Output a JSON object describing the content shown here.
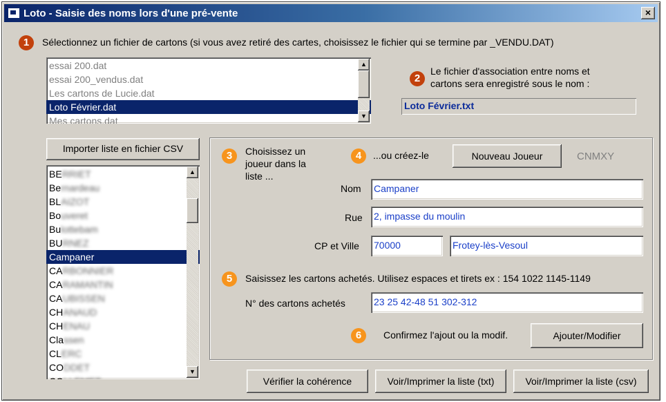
{
  "window": {
    "title": "Loto - Saisie des noms lors d'une pré-vente",
    "close_label": "×"
  },
  "steps": {
    "s1": "1",
    "s2": "2",
    "s3": "3",
    "s4": "4",
    "s5": "5",
    "s6": "6"
  },
  "step1": {
    "instruction": "Sélectionnez un fichier de cartons (si vous avez retiré des cartes, choisissez le fichier qui se termine par _VENDU.DAT)",
    "files": [
      "essai 200.dat",
      "essai 200_vendus.dat",
      "Les cartons de Lucie.dat",
      "Loto Février.dat",
      "Mes cartons.dat"
    ],
    "selected_index": 3
  },
  "step2": {
    "line1": "Le fichier d'association entre noms et",
    "line2": "cartons sera enregistré sous le nom :",
    "output_file": "Loto Février.txt"
  },
  "import_button": "Importer liste en fichier CSV",
  "players": {
    "items": [
      {
        "prefix": "BE",
        "rest": "RRIET"
      },
      {
        "prefix": "Be",
        "rest": "rnardeau"
      },
      {
        "prefix": "BL",
        "rest": "AIZOT"
      },
      {
        "prefix": "Bo",
        "rest": "uveret"
      },
      {
        "prefix": "Bu",
        "rest": "lottebam"
      },
      {
        "prefix": "BU",
        "rest": "RNEZ"
      },
      {
        "prefix": "Campaner",
        "rest": ""
      },
      {
        "prefix": "CA",
        "rest": "RBONNIER"
      },
      {
        "prefix": "CA",
        "rest": "RAMANTIN"
      },
      {
        "prefix": "CA",
        "rest": "UBISSEN"
      },
      {
        "prefix": "CH",
        "rest": "ANAUD"
      },
      {
        "prefix": "CH",
        "rest": "ENAU"
      },
      {
        "prefix": "Cla",
        "rest": "ssen"
      },
      {
        "prefix": "CL",
        "rest": "ERC"
      },
      {
        "prefix": "CO",
        "rest": "DDET"
      },
      {
        "prefix": "CO",
        "rest": "LLEMET"
      }
    ],
    "selected_index": 6
  },
  "step3": {
    "line1": "Choisissez un",
    "line2": "joueur dans la",
    "line3": "liste ..."
  },
  "step4": {
    "text": "...ou créez-le",
    "new_player_button": "Nouveau Joueur",
    "code": "CNMXY"
  },
  "form": {
    "nom_label": "Nom",
    "nom_value": "Campaner",
    "rue_label": "Rue",
    "rue_value": "2, impasse du moulin",
    "cp_label": "CP et Ville",
    "cp_value": "70000",
    "ville_value": "Frotey-lès-Vesoul"
  },
  "step5": {
    "instruction": "Saisissez les cartons achetés. Utilisez espaces et tirets ex : 154  1022  1145-1149",
    "cartons_label": "N° des cartons achetés",
    "cartons_value": "23 25 42-48 51 302-312"
  },
  "step6": {
    "text": "Confirmez l'ajout ou la modif.",
    "add_button": "Ajouter/Modifier"
  },
  "bottom_buttons": {
    "verify": "Vérifier la cohérence",
    "print_txt": "Voir/Imprimer la liste (txt)",
    "print_csv": "Voir/Imprimer la liste (csv)"
  },
  "colors": {
    "step_dark": "#c2410c",
    "step_light": "#f7941d",
    "selection": "#0a246a",
    "field_text": "#1a3fc8"
  }
}
